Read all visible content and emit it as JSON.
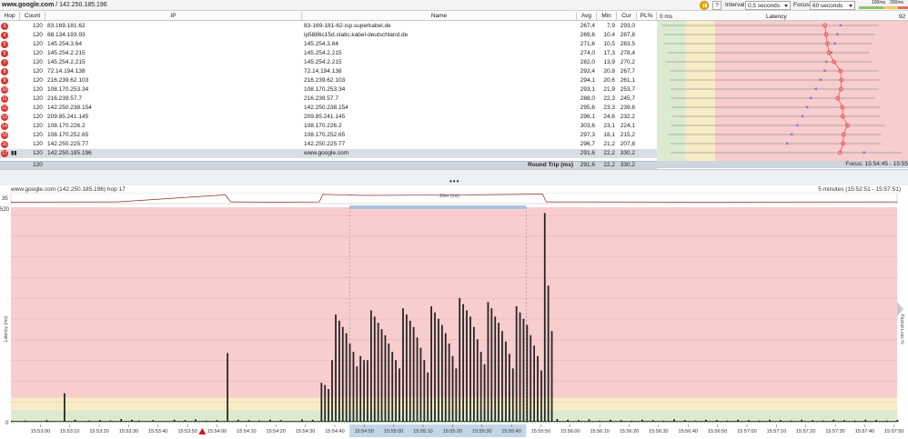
{
  "toolbar": {
    "target_host": "www.google.com",
    "target_rest": " / 142.250.185.196",
    "interval_label": "Interval",
    "interval_value": "0,5 seconds",
    "focus_label": "Focus",
    "focus_value": "60 seconds",
    "scale_legend": [
      "100ms",
      "200ms"
    ],
    "help_glyph": "?"
  },
  "table": {
    "columns": [
      "Hop",
      "Count",
      "IP",
      "Name",
      "Avg",
      "Min",
      "Cur",
      "PL%"
    ],
    "rows": [
      {
        "hop": "3",
        "count": "120",
        "ip": "83.169.181.62",
        "name": "83-169-181-62-isp.superkabel.de",
        "avg": "267,4",
        "min": "7,9",
        "cur": "293,0",
        "pl": ""
      },
      {
        "hop": "4",
        "count": "120",
        "ip": "88.134.193.93",
        "name": "ip5886c15d.static.kabel-deutschland.de",
        "avg": "269,6",
        "min": "10,4",
        "cur": "287,8",
        "pl": ""
      },
      {
        "hop": "5",
        "count": "120",
        "ip": "145.254.3.64",
        "name": "145.254.3.64",
        "avg": "271,6",
        "min": "10,5",
        "cur": "283,5",
        "pl": ""
      },
      {
        "hop": "6",
        "count": "120",
        "ip": "145.254.2.215",
        "name": "145.254.2.215",
        "avg": "274,0",
        "min": "17,3",
        "cur": "278,4",
        "pl": ""
      },
      {
        "hop": "7",
        "count": "120",
        "ip": "145.254.2.215",
        "name": "145.254.2.215",
        "avg": "282,0",
        "min": "13,9",
        "cur": "270,2",
        "pl": ""
      },
      {
        "hop": "8",
        "count": "120",
        "ip": "72.14.194.138",
        "name": "72.14.194.138",
        "avg": "292,4",
        "min": "20,8",
        "cur": "267,7",
        "pl": ""
      },
      {
        "hop": "9",
        "count": "120",
        "ip": "216.239.62.103",
        "name": "216.239.62.103",
        "avg": "294,1",
        "min": "20,6",
        "cur": "261,1",
        "pl": ""
      },
      {
        "hop": "10",
        "count": "120",
        "ip": "108.170.253.34",
        "name": "108.170.253.34",
        "avg": "293,1",
        "min": "21,9",
        "cur": "253,7",
        "pl": ""
      },
      {
        "hop": "11",
        "count": "120",
        "ip": "216.239.57.7",
        "name": "216.239.57.7",
        "avg": "288,0",
        "min": "22,3",
        "cur": "245,7",
        "pl": ""
      },
      {
        "hop": "12",
        "count": "120",
        "ip": "142.250.238.154",
        "name": "142.250.238.154",
        "avg": "295,6",
        "min": "23,3",
        "cur": "239,6",
        "pl": ""
      },
      {
        "hop": "13",
        "count": "120",
        "ip": "209.85.241.145",
        "name": "209.85.241.145",
        "avg": "296,1",
        "min": "24,6",
        "cur": "232,2",
        "pl": ""
      },
      {
        "hop": "14",
        "count": "120",
        "ip": "108.170.226.2",
        "name": "108.170.226.2",
        "avg": "303,6",
        "min": "23,1",
        "cur": "224,1",
        "pl": ""
      },
      {
        "hop": "15",
        "count": "120",
        "ip": "108.170.252.65",
        "name": "108.170.252.65",
        "avg": "297,3",
        "min": "18,1",
        "cur": "215,2",
        "pl": ""
      },
      {
        "hop": "16",
        "count": "120",
        "ip": "142.250.225.77",
        "name": "142.250.225.77",
        "avg": "296,7",
        "min": "21,2",
        "cur": "207,8",
        "pl": ""
      },
      {
        "hop": "17",
        "count": "120",
        "ip": "142.250.185.196",
        "name": "www.google.com",
        "avg": "291,6",
        "min": "22,2",
        "cur": "330,2",
        "pl": "",
        "selected": true
      }
    ],
    "summary": {
      "count": "120",
      "label": "Round Trip (ms)",
      "avg": "291,6",
      "min": "22,2",
      "cur": "330,2"
    }
  },
  "latency_column": {
    "header_left": "0 ms",
    "header_title": "Latency",
    "header_right": "92",
    "focus_text": "Focus: 15:54:45 - 15:55"
  },
  "graph": {
    "title": "www.google.com (142.250.185.196) hop 17",
    "range": "5 minutes (15:52:51 - 15:57:51)",
    "jitter_label": "Jitter (ms)",
    "jitter_max": "35",
    "y_axis_label": "Latency (ms)",
    "right_axis_label": "Packet Loss %",
    "y_top_label": "520",
    "y_zero_label": "0"
  },
  "colors": {
    "zone_green": "#dcebd0",
    "zone_yellow": "#f7ecc6",
    "zone_red": "#f7cdcd",
    "line": "#111111",
    "selection": "#a9c4db",
    "hop_badge": "#dd3333",
    "avg_marker": "#ee4444",
    "min_marker": "#3333cc"
  },
  "chart_data": {
    "type": "line",
    "title": "",
    "xlabel": "",
    "ylabel": "Latency (ms)",
    "ylim": [
      0,
      520
    ],
    "zones_ms": {
      "green_max": 30,
      "yellow_max": 60
    },
    "x_tick_labels": [
      "15:53:00",
      "15:53:10",
      "15:53:20",
      "15:53:30",
      "15:53:40",
      "15:53:50",
      "15:54:00",
      "15:54:10",
      "15:54:20",
      "15:54:30",
      "15:54:40",
      "15:54:50",
      "15:55:00",
      "15:55:10",
      "15:55:20",
      "15:55:30",
      "15:55:40",
      "15:55:50",
      "15:56:00",
      "15:56:10",
      "15:56:20",
      "15:56:30",
      "15:56:40",
      "15:56:50",
      "15:57:00",
      "15:57:10",
      "15:57:20",
      "15:57:30",
      "15:57:40",
      "15:57:50"
    ],
    "x_start": "15:52:50",
    "x_end": "15:57:51",
    "selection_range": [
      "15:54:45",
      "15:55:45"
    ],
    "loss_marker_time": "15:53:55",
    "spikes": [
      {
        "t": 2,
        "v": 3
      },
      {
        "t": 8,
        "v": 4
      },
      {
        "t": 14,
        "v": 3
      },
      {
        "t": 20,
        "v": 5
      },
      {
        "t": 30,
        "v": 70
      },
      {
        "t": 36,
        "v": 6
      },
      {
        "t": 44,
        "v": 4
      },
      {
        "t": 50,
        "v": 5
      },
      {
        "t": 56,
        "v": 4
      },
      {
        "t": 62,
        "v": 8
      },
      {
        "t": 68,
        "v": 6
      },
      {
        "t": 72,
        "v": 4
      },
      {
        "t": 80,
        "v": 5
      },
      {
        "t": 86,
        "v": 3
      },
      {
        "t": 92,
        "v": 6
      },
      {
        "t": 98,
        "v": 5
      },
      {
        "t": 104,
        "v": 7
      },
      {
        "t": 110,
        "v": 4
      },
      {
        "t": 116,
        "v": 5
      },
      {
        "t": 122,
        "v": 167
      },
      {
        "t": 128,
        "v": 6
      },
      {
        "t": 134,
        "v": 5
      },
      {
        "t": 140,
        "v": 4
      },
      {
        "t": 146,
        "v": 6
      },
      {
        "t": 152,
        "v": 5
      },
      {
        "t": 158,
        "v": 3
      },
      {
        "t": 164,
        "v": 7
      },
      {
        "t": 170,
        "v": 6
      },
      {
        "t": 175,
        "v": 95
      },
      {
        "t": 177,
        "v": 90
      },
      {
        "t": 179,
        "v": 80
      },
      {
        "t": 181,
        "v": 150
      },
      {
        "t": 183,
        "v": 260
      },
      {
        "t": 185,
        "v": 245
      },
      {
        "t": 187,
        "v": 230
      },
      {
        "t": 189,
        "v": 215
      },
      {
        "t": 191,
        "v": 190
      },
      {
        "t": 193,
        "v": 170
      },
      {
        "t": 195,
        "v": 135
      },
      {
        "t": 197,
        "v": 160
      },
      {
        "t": 199,
        "v": 150
      },
      {
        "t": 201,
        "v": 150
      },
      {
        "t": 203,
        "v": 270
      },
      {
        "t": 205,
        "v": 255
      },
      {
        "t": 207,
        "v": 240
      },
      {
        "t": 209,
        "v": 225
      },
      {
        "t": 211,
        "v": 210
      },
      {
        "t": 213,
        "v": 190
      },
      {
        "t": 215,
        "v": 170
      },
      {
        "t": 217,
        "v": 150
      },
      {
        "t": 219,
        "v": 130
      },
      {
        "t": 221,
        "v": 275
      },
      {
        "t": 223,
        "v": 260
      },
      {
        "t": 225,
        "v": 245
      },
      {
        "t": 227,
        "v": 230
      },
      {
        "t": 229,
        "v": 205
      },
      {
        "t": 231,
        "v": 180
      },
      {
        "t": 233,
        "v": 150
      },
      {
        "t": 235,
        "v": 120
      },
      {
        "t": 237,
        "v": 280
      },
      {
        "t": 239,
        "v": 265
      },
      {
        "t": 241,
        "v": 250
      },
      {
        "t": 243,
        "v": 235
      },
      {
        "t": 245,
        "v": 215
      },
      {
        "t": 247,
        "v": 190
      },
      {
        "t": 249,
        "v": 160
      },
      {
        "t": 251,
        "v": 130
      },
      {
        "t": 253,
        "v": 300
      },
      {
        "t": 255,
        "v": 285
      },
      {
        "t": 257,
        "v": 270
      },
      {
        "t": 259,
        "v": 255
      },
      {
        "t": 261,
        "v": 230
      },
      {
        "t": 263,
        "v": 200
      },
      {
        "t": 265,
        "v": 170
      },
      {
        "t": 267,
        "v": 140
      },
      {
        "t": 269,
        "v": 290
      },
      {
        "t": 271,
        "v": 275
      },
      {
        "t": 273,
        "v": 255
      },
      {
        "t": 275,
        "v": 240
      },
      {
        "t": 277,
        "v": 220
      },
      {
        "t": 279,
        "v": 195
      },
      {
        "t": 281,
        "v": 165
      },
      {
        "t": 283,
        "v": 130
      },
      {
        "t": 285,
        "v": 280
      },
      {
        "t": 287,
        "v": 265
      },
      {
        "t": 289,
        "v": 250
      },
      {
        "t": 291,
        "v": 235
      },
      {
        "t": 293,
        "v": 210
      },
      {
        "t": 295,
        "v": 185
      },
      {
        "t": 297,
        "v": 160
      },
      {
        "t": 299,
        "v": 125
      },
      {
        "t": 301,
        "v": 505
      },
      {
        "t": 303,
        "v": 330
      },
      {
        "t": 305,
        "v": 220
      },
      {
        "t": 308,
        "v": 8
      },
      {
        "t": 314,
        "v": 6
      },
      {
        "t": 320,
        "v": 5
      },
      {
        "t": 326,
        "v": 7
      },
      {
        "t": 332,
        "v": 4
      },
      {
        "t": 338,
        "v": 6
      },
      {
        "t": 344,
        "v": 5
      },
      {
        "t": 350,
        "v": 4
      },
      {
        "t": 356,
        "v": 6
      },
      {
        "t": 362,
        "v": 5
      },
      {
        "t": 368,
        "v": 4
      },
      {
        "t": 374,
        "v": 7
      },
      {
        "t": 380,
        "v": 5
      },
      {
        "t": 386,
        "v": 4
      },
      {
        "t": 392,
        "v": 6
      },
      {
        "t": 398,
        "v": 5
      },
      {
        "t": 404,
        "v": 4
      },
      {
        "t": 410,
        "v": 6
      },
      {
        "t": 416,
        "v": 5
      },
      {
        "t": 422,
        "v": 4
      },
      {
        "t": 428,
        "v": 6
      },
      {
        "t": 434,
        "v": 5
      },
      {
        "t": 440,
        "v": 4
      },
      {
        "t": 446,
        "v": 6
      },
      {
        "t": 452,
        "v": 5
      },
      {
        "t": 458,
        "v": 4
      },
      {
        "t": 464,
        "v": 6
      },
      {
        "t": 470,
        "v": 5
      },
      {
        "t": 476,
        "v": 4
      },
      {
        "t": 482,
        "v": 6
      },
      {
        "t": 488,
        "v": 5
      },
      {
        "t": 494,
        "v": 4
      },
      {
        "t": 500,
        "v": 6
      }
    ],
    "spike_time_note": "",
    "jitter": [
      {
        "t": 0,
        "v": 2
      },
      {
        "t": 60,
        "v": 3
      },
      {
        "t": 121,
        "v": 30
      },
      {
        "t": 124,
        "v": 3
      },
      {
        "t": 150,
        "v": 2
      },
      {
        "t": 174,
        "v": 3
      },
      {
        "t": 176,
        "v": 32
      },
      {
        "t": 200,
        "v": 28
      },
      {
        "t": 260,
        "v": 30
      },
      {
        "t": 300,
        "v": 33
      },
      {
        "t": 302,
        "v": 3
      },
      {
        "t": 400,
        "v": 2
      },
      {
        "t": 500,
        "v": 3
      }
    ]
  }
}
